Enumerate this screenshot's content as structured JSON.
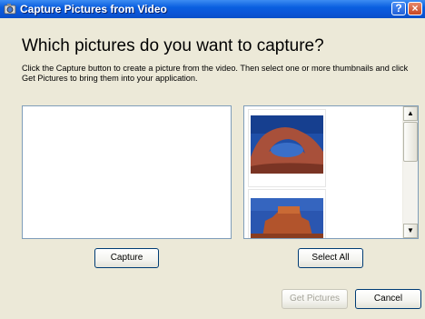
{
  "window": {
    "title": "Capture Pictures from Video",
    "help_label": "?",
    "close_label": "×"
  },
  "header": {
    "title": "Which pictures do you want to capture?",
    "description": "Click the Capture button to create a picture from the video.  Then select one or more thumbnails and click Get Pictures to bring them into your application."
  },
  "thumbnails": [
    {
      "icon": "rock-arch-photo"
    },
    {
      "icon": "butte-photo"
    }
  ],
  "buttons": {
    "capture": "Capture",
    "select_all": "Select All",
    "get_pictures": "Get Pictures",
    "cancel": "Cancel"
  },
  "colors": {
    "titlebar": "#0a5fe0",
    "dialog_bg": "#ece9d8",
    "pane_border": "#7f9db9"
  }
}
